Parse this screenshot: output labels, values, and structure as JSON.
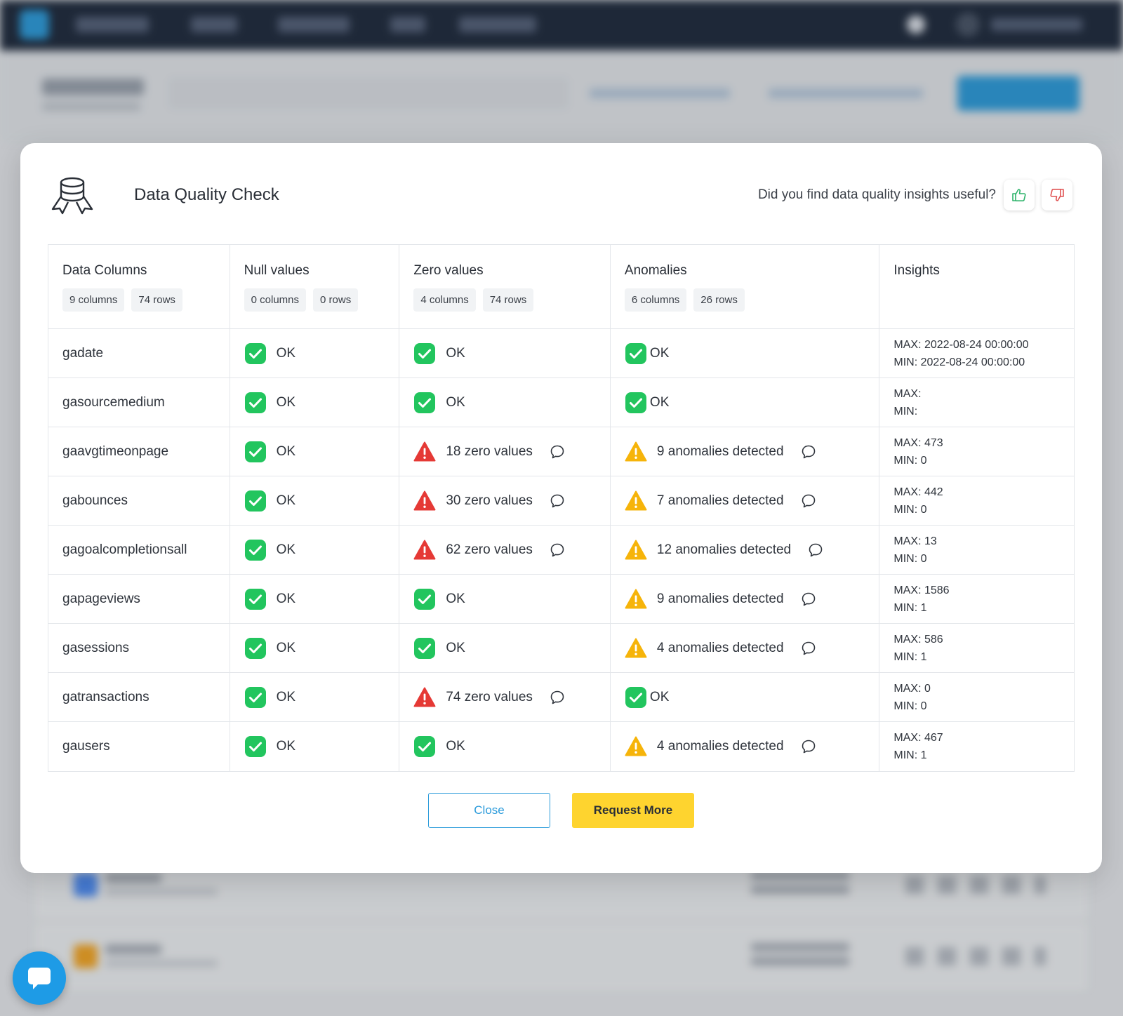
{
  "modal": {
    "title": "Data Quality Check",
    "feedback_question": "Did you find data quality insights useful?",
    "close_label": "Close",
    "request_label": "Request More"
  },
  "headers": {
    "data_columns": {
      "label": "Data Columns",
      "b1": "9 columns",
      "b2": "74 rows"
    },
    "null_values": {
      "label": "Null values",
      "b1": "0 columns",
      "b2": "0 rows"
    },
    "zero_values": {
      "label": "Zero values",
      "b1": "4 columns",
      "b2": "74 rows"
    },
    "anomalies": {
      "label": "Anomalies",
      "b1": "6 columns",
      "b2": "26 rows"
    },
    "insights": {
      "label": "Insights"
    }
  },
  "rows": [
    {
      "name": "gadate",
      "null": "OK",
      "zero": "OK",
      "zero_state": "ok",
      "anom": "OK",
      "anom_state": "ok",
      "max": "MAX: 2022-08-24 00:00:00",
      "min": "MIN: 2022-08-24 00:00:00"
    },
    {
      "name": "gasourcemedium",
      "null": "OK",
      "zero": "OK",
      "zero_state": "ok",
      "anom": "OK",
      "anom_state": "ok",
      "max": "MAX:",
      "min": "MIN:"
    },
    {
      "name": "gaavgtimeonpage",
      "null": "OK",
      "zero": "18 zero values",
      "zero_state": "error",
      "anom": "9 anomalies detected",
      "anom_state": "warn",
      "max": "MAX: 473",
      "min": "MIN: 0"
    },
    {
      "name": "gabounces",
      "null": "OK",
      "zero": "30 zero values",
      "zero_state": "error",
      "anom": "7 anomalies detected",
      "anom_state": "warn",
      "max": "MAX: 442",
      "min": "MIN: 0"
    },
    {
      "name": "gagoalcompletionsall",
      "null": "OK",
      "zero": "62 zero values",
      "zero_state": "error",
      "anom": "12 anomalies detected",
      "anom_state": "warn",
      "max": "MAX: 13",
      "min": "MIN: 0"
    },
    {
      "name": "gapageviews",
      "null": "OK",
      "zero": "OK",
      "zero_state": "ok",
      "anom": "9 anomalies detected",
      "anom_state": "warn",
      "max": "MAX: 1586",
      "min": "MIN: 1"
    },
    {
      "name": "gasessions",
      "null": "OK",
      "zero": "OK",
      "zero_state": "ok",
      "anom": "4 anomalies detected",
      "anom_state": "warn",
      "max": "MAX: 586",
      "min": "MIN: 1"
    },
    {
      "name": "gatransactions",
      "null": "OK",
      "zero": "74 zero values",
      "zero_state": "error",
      "anom": "OK",
      "anom_state": "ok",
      "max": "MAX: 0",
      "min": "MIN: 0"
    },
    {
      "name": "gausers",
      "null": "OK",
      "zero": "OK",
      "zero_state": "ok",
      "anom": "4 anomalies detected",
      "anom_state": "warn",
      "max": "MAX: 467",
      "min": "MIN: 1"
    }
  ],
  "icons": {
    "ok": "check-icon",
    "error": "error-triangle-icon",
    "warn": "warning-triangle-icon",
    "comment": "comment-icon",
    "thumbs_up": "thumbs-up-icon",
    "thumbs_down": "thumbs-down-icon",
    "chat": "chat-icon"
  },
  "colors": {
    "ok": "#22c55e",
    "error": "#e53935",
    "warn": "#f6b40a",
    "primary": "#2d9cdb",
    "accent": "#fed42f"
  }
}
